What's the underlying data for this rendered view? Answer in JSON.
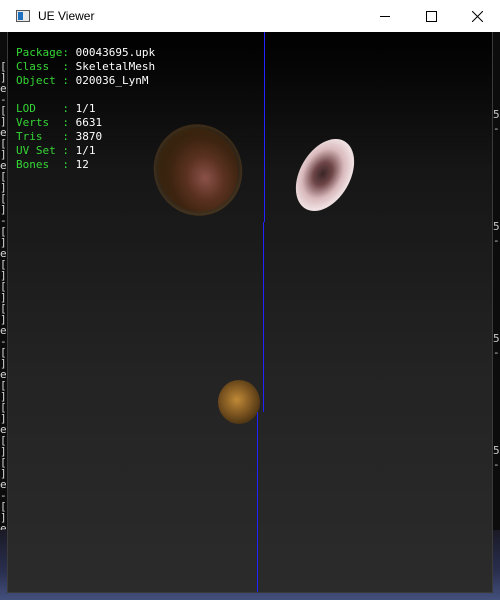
{
  "window": {
    "title": "UE Viewer",
    "controls": {
      "minimize_icon": "minimize-icon",
      "maximize_icon": "maximize-icon",
      "close_icon": "close-icon"
    }
  },
  "info": {
    "package": {
      "label": "Package:",
      "value": "00043695.upk"
    },
    "class": {
      "label": "Class  :",
      "value": "SkeletalMesh"
    },
    "object": {
      "label": "Object :",
      "value": "020036_LynM"
    },
    "lod": {
      "label": "LOD    :",
      "value": "1/1"
    },
    "verts": {
      "label": "Verts  :",
      "value": "6631"
    },
    "tris": {
      "label": "Tris   :",
      "value": "3870"
    },
    "uvset": {
      "label": "UV Set :",
      "value": "1/1"
    },
    "bones": {
      "label": "Bones  :",
      "value": "12"
    }
  },
  "colors": {
    "label_green": "#35d635",
    "value_white": "#ffffff",
    "axis_blue": "#2323ff"
  },
  "background_console": {
    "left_glyphs": [
      "[",
      "]",
      "e",
      "-",
      "[",
      "]",
      "e",
      "[",
      "]",
      "e",
      "[",
      "]",
      "[",
      "]",
      "-",
      "[",
      "]",
      "e",
      "[",
      "]",
      "[",
      "]",
      "[",
      "]",
      "e",
      "-",
      "[",
      "]",
      "e",
      "[",
      "]",
      "[",
      "]",
      "e",
      "[",
      "]",
      "[",
      "]",
      "e",
      "-",
      "[",
      "]",
      "e",
      "[",
      "]"
    ],
    "right_glyphs": [
      "5",
      "-",
      "5",
      "-",
      "5",
      "-",
      "5",
      "-",
      "5",
      "-"
    ]
  }
}
